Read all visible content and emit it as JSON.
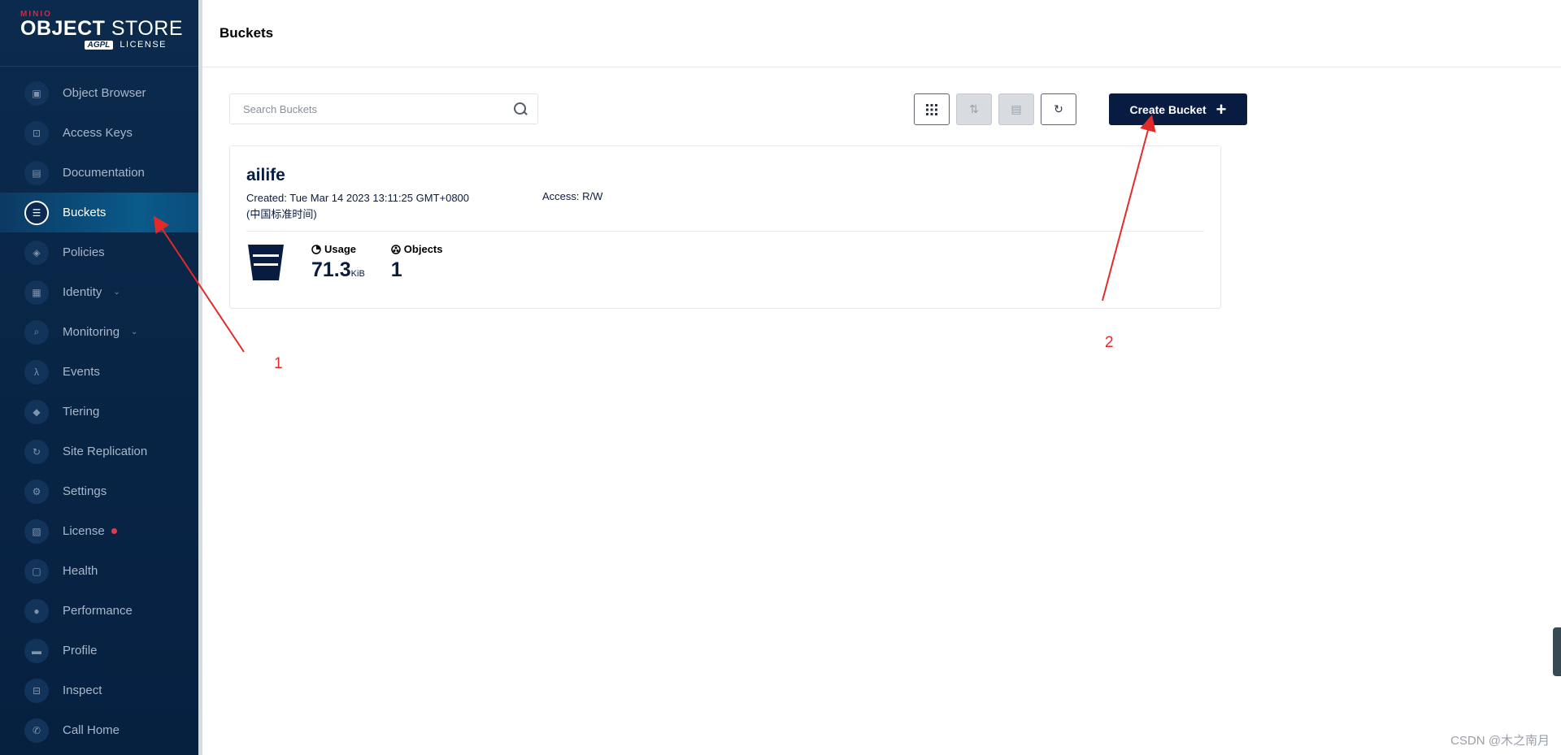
{
  "brand": {
    "top": "MINIO",
    "store_bold": "OBJECT",
    "store_light": "STORE",
    "badge": "AGPL",
    "license": "LICENSE"
  },
  "nav": [
    {
      "label": "Object Browser",
      "icon": "object-browser-icon"
    },
    {
      "label": "Access Keys",
      "icon": "access-keys-icon"
    },
    {
      "label": "Documentation",
      "icon": "documentation-icon"
    },
    {
      "label": "Buckets",
      "icon": "bucket-icon",
      "active": true
    },
    {
      "label": "Policies",
      "icon": "shield-icon"
    },
    {
      "label": "Identity",
      "icon": "id-card-icon",
      "chevron": true
    },
    {
      "label": "Monitoring",
      "icon": "magnifier-icon",
      "chevron": true
    },
    {
      "label": "Events",
      "icon": "lambda-icon"
    },
    {
      "label": "Tiering",
      "icon": "layers-icon"
    },
    {
      "label": "Site Replication",
      "icon": "replication-icon"
    },
    {
      "label": "Settings",
      "icon": "gear-icon"
    },
    {
      "label": "License",
      "icon": "license-icon",
      "badge": true
    },
    {
      "label": "Health",
      "icon": "health-icon"
    },
    {
      "label": "Performance",
      "icon": "speedometer-icon"
    },
    {
      "label": "Profile",
      "icon": "profile-icon"
    },
    {
      "label": "Inspect",
      "icon": "inspect-icon"
    },
    {
      "label": "Call Home",
      "icon": "phone-icon"
    }
  ],
  "page": {
    "title": "Buckets"
  },
  "search": {
    "placeholder": "Search Buckets",
    "value": ""
  },
  "toolbar": {
    "list_icon": "grid-icon",
    "replicate_icon": "replicate-icon",
    "delete_icon": "delete-icon",
    "refresh_icon": "refresh-icon",
    "create_label": "Create Bucket"
  },
  "bucket": {
    "name": "ailife",
    "created": "Created: Tue Mar 14 2023 13:11:25 GMT+0800",
    "created_tz": "(中国标准时间)",
    "access": "Access: R/W",
    "usage_label": "Usage",
    "usage_value": "71.3",
    "usage_unit": "KiB",
    "objects_label": "Objects",
    "objects_value": "1"
  },
  "annotations": {
    "one": "1",
    "two": "2"
  },
  "watermark": "CSDN @木之南月",
  "colors": {
    "accent": "#081c42",
    "sidebar": "#0b2a4d",
    "annotation": "#e32a2a",
    "license_dot": "#e4384d"
  }
}
